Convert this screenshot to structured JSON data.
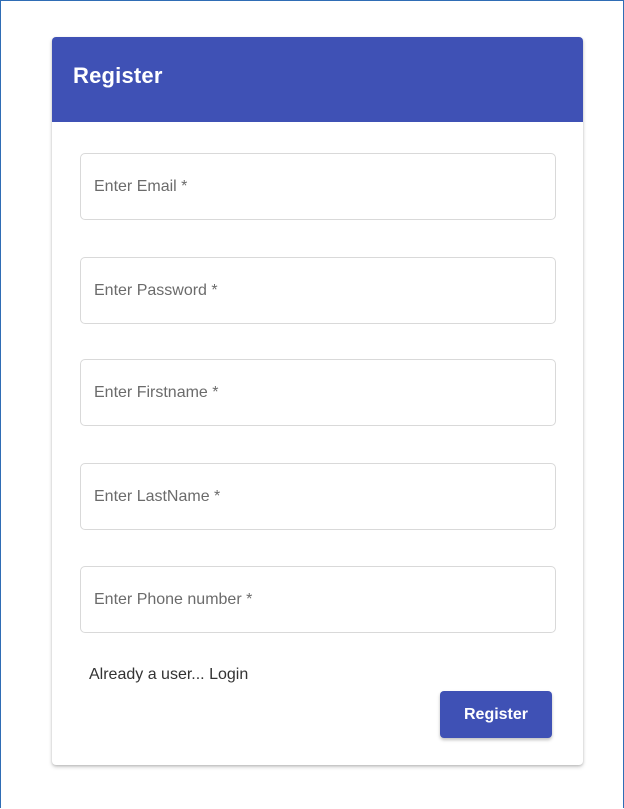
{
  "card": {
    "title": "Register"
  },
  "form": {
    "email_placeholder": "Enter Email *",
    "password_placeholder": "Enter Password *",
    "firstname_placeholder": "Enter Firstname *",
    "lastname_placeholder": "Enter LastName *",
    "phone_placeholder": "Enter Phone number *",
    "email_value": "",
    "password_value": "",
    "firstname_value": "",
    "lastname_value": "",
    "phone_value": ""
  },
  "actions": {
    "login_link_label": "Already a user... Login",
    "register_button_label": "Register"
  },
  "colors": {
    "primary": "#3f51b5",
    "frame_border": "#2f6db5",
    "field_border": "#d9d9d9"
  }
}
